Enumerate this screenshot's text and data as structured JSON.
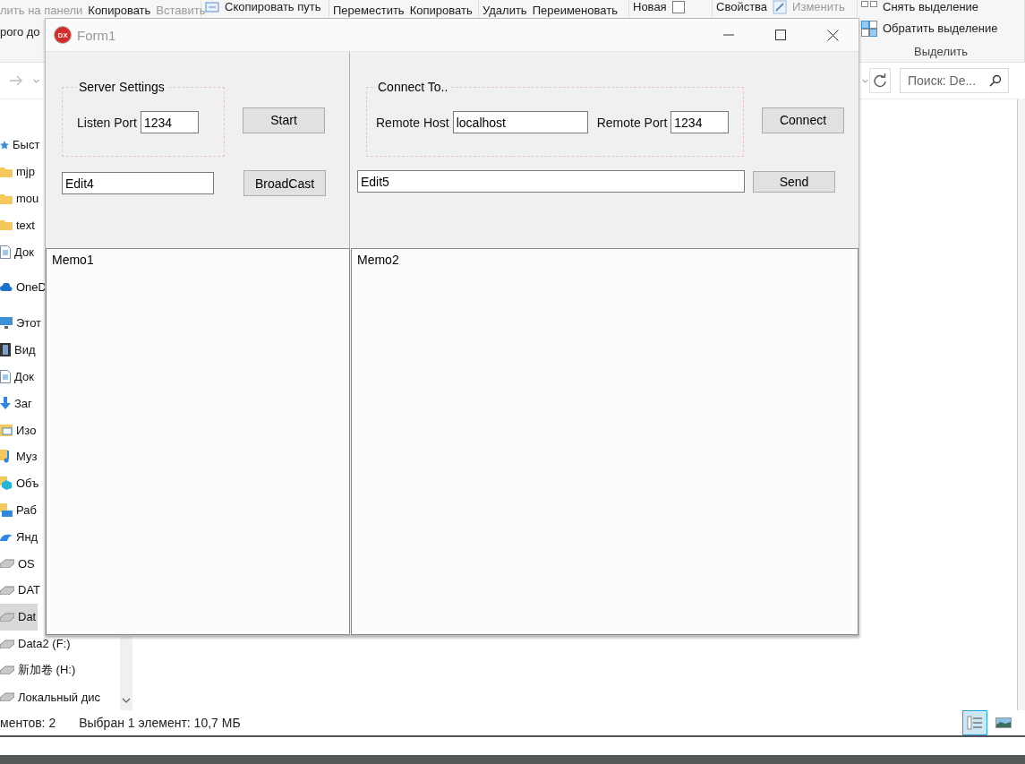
{
  "explorer": {
    "ribbon": {
      "groups": [
        {
          "rows": [
            [
              {
                "label": "лить на панели",
                "disabled": true
              },
              {
                "label": "Копировать",
                "disabled": false
              },
              {
                "label": "Вставить",
                "disabled": true
              }
            ],
            [
              {
                "label": "рого до",
                "disabled": false
              }
            ]
          ]
        },
        {
          "rows": [
            [
              {
                "kind": "copy-path",
                "label": "Скопировать путь",
                "disabled": false
              }
            ]
          ]
        },
        {
          "rows": [
            [
              {
                "label": "Переместить",
                "disabled": false
              },
              {
                "label": "Копировать",
                "disabled": false
              }
            ]
          ]
        },
        {
          "rows": [
            [
              {
                "label": "Удалить",
                "disabled": false
              },
              {
                "label": "Переименовать",
                "disabled": false
              }
            ]
          ]
        },
        {
          "rows": [
            [
              {
                "label": "Новая",
                "disabled": false
              },
              {
                "kind": "checkbox"
              }
            ]
          ]
        },
        {
          "rows": [
            [
              {
                "label": "Свойства",
                "disabled": false
              },
              {
                "kind": "edit",
                "label": "Изменить",
                "disabled": true
              }
            ]
          ]
        },
        {
          "rows": [
            [
              {
                "kind": "select-none",
                "label": "Снять выделение",
                "disabled": false
              }
            ],
            [
              {
                "kind": "invert",
                "label": "Обратить выделение",
                "disabled": false
              }
            ]
          ],
          "label": "Выделить"
        }
      ]
    },
    "search": {
      "placeholder": "Поиск: De..."
    },
    "sidebar": {
      "items": [
        {
          "label": "Быст",
          "kind": "star",
          "selected": false
        },
        {
          "label": "mjp",
          "kind": "folder",
          "selected": false
        },
        {
          "label": "mou",
          "kind": "folder",
          "selected": false
        },
        {
          "label": "text",
          "kind": "folder",
          "selected": false
        },
        {
          "label": "Док",
          "kind": "doc",
          "selected": false
        },
        {
          "label": "OneD",
          "kind": "cloud",
          "selected": false
        },
        {
          "label": "Этот",
          "kind": "pc",
          "selected": false
        },
        {
          "label": "Вид",
          "kind": "video",
          "selected": false
        },
        {
          "label": "Док",
          "kind": "doc",
          "selected": false
        },
        {
          "label": "Заг",
          "kind": "download",
          "selected": false
        },
        {
          "label": "Изо",
          "kind": "image",
          "selected": false
        },
        {
          "label": "Муз",
          "kind": "music",
          "selected": false
        },
        {
          "label": "Объ",
          "kind": "cube",
          "selected": false
        },
        {
          "label": "Раб",
          "kind": "desktop",
          "selected": false
        },
        {
          "label": "Янд",
          "kind": "yandex",
          "selected": false
        },
        {
          "label": "OS",
          "kind": "drive",
          "selected": false
        },
        {
          "label": "DAT",
          "kind": "drive",
          "selected": false
        },
        {
          "label": "Dat",
          "kind": "drive",
          "selected": true
        },
        {
          "label": "Data2 (F:)",
          "kind": "drive",
          "selected": false
        },
        {
          "label": "新加卷 (H:)",
          "kind": "drive",
          "selected": false
        },
        {
          "label": "Локальный дис",
          "kind": "drive",
          "selected": false
        }
      ]
    },
    "status_bar": {
      "count": "ментов: 2",
      "selection": "Выбран 1 элемент: 10,7 МБ"
    },
    "view_buttons": [
      {
        "kind": "details",
        "selected": true
      },
      {
        "kind": "tiles",
        "selected": false
      }
    ]
  },
  "form": {
    "logo": "DX",
    "title": "Form1",
    "server": {
      "title": "Server Settings",
      "port_label": "Listen Port",
      "port_value": "1234",
      "start_button": "Start",
      "message_value": "Edit4",
      "broadcast_button": "BroadCast",
      "memo": "Memo1"
    },
    "client": {
      "title": "Connect To..",
      "host_label": "Remote Host",
      "host_value": "localhost",
      "port_label": "Remote Port",
      "port_value": "1234",
      "connect_button": "Connect",
      "message_value": "Edit5",
      "send_button": "Send",
      "memo": "Memo2"
    }
  }
}
